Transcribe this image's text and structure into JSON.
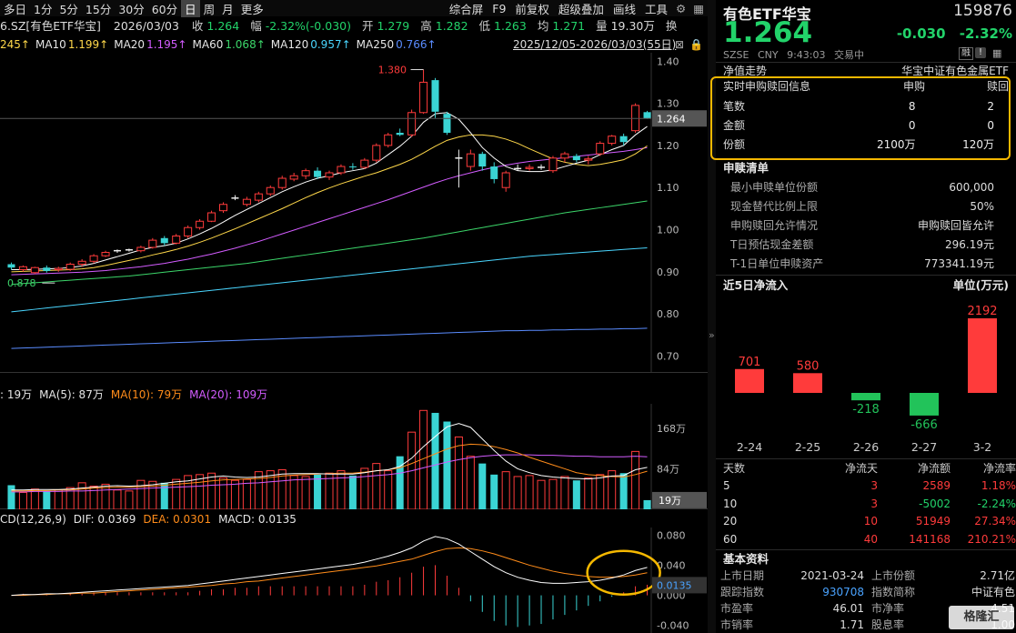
{
  "toolbar": {
    "items": [
      "多日",
      "1分",
      "5分",
      "15分",
      "30分",
      "60分",
      "日",
      "周",
      "月",
      "更多"
    ],
    "active": "日",
    "right_items": [
      "综合屏",
      "F9",
      "前复权",
      "超级叠加",
      "画线",
      "工具"
    ],
    "settings_icon": "gear-icon",
    "menu_icon": "grid-icon"
  },
  "info_row": {
    "code_name": "6.SZ[有色ETF华宝]",
    "date": "2026/03/03",
    "close_label": "收",
    "close_value": "1.264",
    "change_label": "幅",
    "change_value": "-2.32%(-0.030)",
    "open_label": "开",
    "open_value": "1.279",
    "high_label": "高",
    "high_value": "1.282",
    "low_label": "低",
    "low_value": "1.263",
    "avg_label": "均",
    "avg_value": "1.271",
    "volume_label": "量",
    "volume_value": "19.30万",
    "turnover_label": "换"
  },
  "ma_row": {
    "items": [
      {
        "label": "245↑",
        "color": "#ffd84a"
      },
      {
        "label": "MA10",
        "color": "#e6e6e6"
      },
      {
        "label": "1.199↑",
        "color": "#ffd84a"
      },
      {
        "label": "MA20",
        "color": "#e6e6e6"
      },
      {
        "label": "1.195↑",
        "color": "#d35cff"
      },
      {
        "label": "MA60",
        "color": "#e6e6e6"
      },
      {
        "label": "1.068↑",
        "color": "#3cd66a"
      },
      {
        "label": "MA120",
        "color": "#e6e6e6"
      },
      {
        "label": "0.957↑",
        "color": "#4ad6ff"
      },
      {
        "label": "MA250",
        "color": "#e6e6e6"
      },
      {
        "label": "0.766↑",
        "color": "#5a8cff"
      }
    ],
    "range": "2025/12/05-2026/03/03(55日)"
  },
  "price_axis": [
    "1.40",
    "1.30",
    "1.20",
    "1.10",
    "1.00",
    "0.90",
    "0.80",
    "0.70"
  ],
  "price_annotations": {
    "high": "1.380",
    "low": "0.878",
    "current": "1.264"
  },
  "volume_row": {
    "items": [
      {
        "label": ": 19万",
        "color": "#e6e6e6"
      },
      {
        "label": "MA(5): 87万",
        "color": "#e6e6e6"
      },
      {
        "label": "MA(10): 79万",
        "color": "#ff8c1a"
      },
      {
        "label": "MA(20): 109万",
        "color": "#d35cff"
      }
    ],
    "axis": [
      "168万",
      "84万"
    ],
    "current": "19万"
  },
  "macd_row": {
    "items": [
      {
        "label": "CD(12,26,9)",
        "color": "#e6e6e6"
      },
      {
        "label": "DIF: 0.0369",
        "color": "#e6e6e6"
      },
      {
        "label": "DEA: 0.0301",
        "color": "#ff8c1a"
      },
      {
        "label": "MACD: 0.0135",
        "color": "#e6e6e6"
      }
    ],
    "axis": [
      "0.080",
      "0.040",
      "0.000",
      "-0.040"
    ],
    "current": "0.0135"
  },
  "chart_data": {
    "type": "candlestick",
    "candles": [
      {
        "o": 0.918,
        "c": 0.91,
        "h": 0.922,
        "l": 0.905
      },
      {
        "o": 0.905,
        "c": 0.912,
        "h": 0.915,
        "l": 0.9
      },
      {
        "o": 0.898,
        "c": 0.91,
        "h": 0.912,
        "l": 0.895
      },
      {
        "o": 0.91,
        "c": 0.902,
        "h": 0.915,
        "l": 0.898
      },
      {
        "o": 0.905,
        "c": 0.908,
        "h": 0.912,
        "l": 0.9
      },
      {
        "o": 0.906,
        "c": 0.918,
        "h": 0.922,
        "l": 0.902
      },
      {
        "o": 0.918,
        "c": 0.925,
        "h": 0.93,
        "l": 0.912
      },
      {
        "o": 0.925,
        "c": 0.938,
        "h": 0.942,
        "l": 0.92
      },
      {
        "o": 0.938,
        "c": 0.946,
        "h": 0.95,
        "l": 0.935
      },
      {
        "o": 0.95,
        "c": 0.95,
        "h": 0.953,
        "l": 0.945
      },
      {
        "o": 0.952,
        "c": 0.952,
        "h": 0.955,
        "l": 0.948
      },
      {
        "o": 0.95,
        "c": 0.958,
        "h": 0.962,
        "l": 0.946
      },
      {
        "o": 0.958,
        "c": 0.975,
        "h": 0.98,
        "l": 0.955
      },
      {
        "o": 0.98,
        "c": 0.968,
        "h": 0.985,
        "l": 0.962
      },
      {
        "o": 0.968,
        "c": 0.985,
        "h": 0.99,
        "l": 0.965
      },
      {
        "o": 0.985,
        "c": 1.005,
        "h": 1.01,
        "l": 0.98
      },
      {
        "o": 1.005,
        "c": 1.02,
        "h": 1.025,
        "l": 1.0
      },
      {
        "o": 1.02,
        "c": 1.04,
        "h": 1.045,
        "l": 1.018
      },
      {
        "o": 1.045,
        "c": 1.06,
        "h": 1.065,
        "l": 1.04
      },
      {
        "o": 1.075,
        "c": 1.075,
        "h": 1.082,
        "l": 1.07
      },
      {
        "o": 1.06,
        "c": 1.072,
        "h": 1.078,
        "l": 1.055
      },
      {
        "o": 1.07,
        "c": 1.085,
        "h": 1.09,
        "l": 1.065
      },
      {
        "o": 1.085,
        "c": 1.1,
        "h": 1.105,
        "l": 1.08
      },
      {
        "o": 1.1,
        "c": 1.122,
        "h": 1.128,
        "l": 1.095
      },
      {
        "o": 1.12,
        "c": 1.128,
        "h": 1.135,
        "l": 1.115
      },
      {
        "o": 1.128,
        "c": 1.14,
        "h": 1.145,
        "l": 1.12
      },
      {
        "o": 1.14,
        "c": 1.125,
        "h": 1.148,
        "l": 1.12
      },
      {
        "o": 1.125,
        "c": 1.135,
        "h": 1.14,
        "l": 1.118
      },
      {
        "o": 1.135,
        "c": 1.15,
        "h": 1.155,
        "l": 1.13
      },
      {
        "o": 1.15,
        "c": 1.148,
        "h": 1.158,
        "l": 1.142
      },
      {
        "o": 1.148,
        "c": 1.165,
        "h": 1.17,
        "l": 1.144
      },
      {
        "o": 1.165,
        "c": 1.2,
        "h": 1.205,
        "l": 1.16
      },
      {
        "o": 1.2,
        "c": 1.225,
        "h": 1.23,
        "l": 1.195
      },
      {
        "o": 1.23,
        "c": 1.225,
        "h": 1.24,
        "l": 1.222
      },
      {
        "o": 1.225,
        "c": 1.278,
        "h": 1.285,
        "l": 1.22
      },
      {
        "o": 1.278,
        "c": 1.35,
        "h": 1.38,
        "l": 1.275
      },
      {
        "o": 1.355,
        "c": 1.28,
        "h": 1.36,
        "l": 1.265
      },
      {
        "o": 1.275,
        "c": 1.23,
        "h": 1.28,
        "l": 1.225
      },
      {
        "o": 1.17,
        "c": 1.17,
        "h": 1.19,
        "l": 1.1
      },
      {
        "o": 1.15,
        "c": 1.18,
        "h": 1.19,
        "l": 1.14
      },
      {
        "o": 1.18,
        "c": 1.15,
        "h": 1.185,
        "l": 1.14
      },
      {
        "o": 1.15,
        "c": 1.12,
        "h": 1.16,
        "l": 1.11
      },
      {
        "o": 1.1,
        "c": 1.135,
        "h": 1.14,
        "l": 1.09
      },
      {
        "o": 1.145,
        "c": 1.145,
        "h": 1.155,
        "l": 1.14
      },
      {
        "o": 1.145,
        "c": 1.148,
        "h": 1.155,
        "l": 1.14
      },
      {
        "o": 1.148,
        "c": 1.148,
        "h": 1.155,
        "l": 1.142
      },
      {
        "o": 1.14,
        "c": 1.17,
        "h": 1.175,
        "l": 1.135
      },
      {
        "o": 1.17,
        "c": 1.18,
        "h": 1.185,
        "l": 1.16
      },
      {
        "o": 1.175,
        "c": 1.165,
        "h": 1.18,
        "l": 1.16
      },
      {
        "o": 1.165,
        "c": 1.168,
        "h": 1.175,
        "l": 1.155
      },
      {
        "o": 1.18,
        "c": 1.205,
        "h": 1.21,
        "l": 1.175
      },
      {
        "o": 1.205,
        "c": 1.222,
        "h": 1.225,
        "l": 1.2
      },
      {
        "o": 1.222,
        "c": 1.208,
        "h": 1.228,
        "l": 1.2
      },
      {
        "o": 1.235,
        "c": 1.295,
        "h": 1.3,
        "l": 1.23
      },
      {
        "o": 1.279,
        "c": 1.264,
        "h": 1.282,
        "l": 1.263
      }
    ],
    "ma5": [
      0.905,
      0.905,
      0.906,
      0.907,
      0.908,
      0.91,
      0.914,
      0.92,
      0.928,
      0.936,
      0.944,
      0.952,
      0.958,
      0.962,
      0.968,
      0.978,
      0.99,
      1.003,
      1.018,
      1.034,
      1.048,
      1.062,
      1.076,
      1.09,
      1.102,
      1.113,
      1.122,
      1.128,
      1.135,
      1.14,
      1.145,
      1.158,
      1.178,
      1.198,
      1.222,
      1.255,
      1.275,
      1.278,
      1.262,
      1.23,
      1.195,
      1.17,
      1.15,
      1.14,
      1.138,
      1.138,
      1.142,
      1.15,
      1.158,
      1.165,
      1.178,
      1.19,
      1.2,
      1.225,
      1.245
    ],
    "ma10": [
      0.9,
      0.901,
      0.902,
      0.903,
      0.904,
      0.905,
      0.907,
      0.91,
      0.915,
      0.921,
      0.927,
      0.933,
      0.94,
      0.946,
      0.953,
      0.961,
      0.97,
      0.98,
      0.991,
      1.002,
      1.014,
      1.026,
      1.038,
      1.05,
      1.063,
      1.076,
      1.088,
      1.099,
      1.109,
      1.118,
      1.127,
      1.135,
      1.145,
      1.155,
      1.167,
      1.182,
      1.198,
      1.212,
      1.22,
      1.225,
      1.225,
      1.222,
      1.215,
      1.205,
      1.192,
      1.18,
      1.168,
      1.16,
      1.155,
      1.152,
      1.155,
      1.16,
      1.166,
      1.18,
      1.199
    ],
    "ma20": [
      0.893,
      0.894,
      0.895,
      0.896,
      0.897,
      0.898,
      0.899,
      0.901,
      0.903,
      0.906,
      0.909,
      0.912,
      0.916,
      0.92,
      0.925,
      0.93,
      0.936,
      0.942,
      0.949,
      0.956,
      0.964,
      0.972,
      0.981,
      0.99,
      0.999,
      1.008,
      1.017,
      1.026,
      1.035,
      1.044,
      1.053,
      1.062,
      1.071,
      1.081,
      1.091,
      1.101,
      1.111,
      1.12,
      1.128,
      1.135,
      1.142,
      1.148,
      1.153,
      1.158,
      1.162,
      1.165,
      1.168,
      1.171,
      1.174,
      1.177,
      1.18,
      1.183,
      1.186,
      1.19,
      1.195
    ],
    "ma60": [
      0.87,
      0.872,
      0.874,
      0.876,
      0.878,
      0.88,
      0.882,
      0.884,
      0.886,
      0.888,
      0.89,
      0.893,
      0.896,
      0.899,
      0.902,
      0.905,
      0.908,
      0.911,
      0.914,
      0.917,
      0.92,
      0.924,
      0.928,
      0.932,
      0.936,
      0.94,
      0.944,
      0.948,
      0.952,
      0.956,
      0.96,
      0.964,
      0.968,
      0.972,
      0.976,
      0.98,
      0.985,
      0.99,
      0.995,
      1.0,
      1.005,
      1.01,
      1.015,
      1.02,
      1.025,
      1.03,
      1.035,
      1.04,
      1.044,
      1.048,
      1.052,
      1.056,
      1.06,
      1.064,
      1.068
    ],
    "ma120": [
      0.805,
      0.808,
      0.811,
      0.814,
      0.817,
      0.82,
      0.823,
      0.826,
      0.829,
      0.832,
      0.835,
      0.838,
      0.841,
      0.844,
      0.847,
      0.85,
      0.853,
      0.856,
      0.859,
      0.862,
      0.865,
      0.868,
      0.871,
      0.874,
      0.877,
      0.88,
      0.883,
      0.886,
      0.889,
      0.892,
      0.895,
      0.898,
      0.901,
      0.904,
      0.907,
      0.91,
      0.913,
      0.916,
      0.919,
      0.922,
      0.925,
      0.928,
      0.931,
      0.934,
      0.937,
      0.939,
      0.941,
      0.943,
      0.945,
      0.947,
      0.949,
      0.951,
      0.953,
      0.955,
      0.957
    ],
    "ma250": [
      0.718,
      0.719,
      0.72,
      0.721,
      0.722,
      0.723,
      0.724,
      0.725,
      0.726,
      0.727,
      0.728,
      0.729,
      0.73,
      0.731,
      0.732,
      0.733,
      0.734,
      0.735,
      0.736,
      0.737,
      0.738,
      0.739,
      0.74,
      0.741,
      0.742,
      0.743,
      0.744,
      0.745,
      0.746,
      0.747,
      0.748,
      0.749,
      0.75,
      0.751,
      0.752,
      0.753,
      0.754,
      0.755,
      0.756,
      0.757,
      0.758,
      0.759,
      0.76,
      0.76,
      0.761,
      0.761,
      0.762,
      0.762,
      0.763,
      0.763,
      0.764,
      0.764,
      0.765,
      0.765,
      0.766
    ],
    "volume": [
      50,
      35,
      42,
      38,
      40,
      45,
      55,
      48,
      52,
      40,
      38,
      60,
      58,
      55,
      62,
      70,
      72,
      75,
      65,
      60,
      62,
      78,
      80,
      82,
      70,
      68,
      72,
      75,
      80,
      70,
      85,
      95,
      80,
      110,
      160,
      205,
      200,
      182,
      150,
      110,
      95,
      72,
      78,
      68,
      70,
      60,
      62,
      68,
      60,
      65,
      72,
      80,
      75,
      120,
      19
    ],
    "vol_ma5": [
      40,
      40,
      41,
      41,
      41,
      42,
      44,
      46,
      48,
      49,
      48,
      49,
      51,
      54,
      57,
      59,
      63,
      67,
      69,
      67,
      66,
      67,
      70,
      73,
      74,
      74,
      74,
      73,
      73,
      73,
      76,
      80,
      82,
      89,
      106,
      130,
      151,
      171,
      178,
      170,
      146,
      122,
      100,
      84,
      76,
      70,
      67,
      65,
      64,
      63,
      65,
      69,
      70,
      82,
      87
    ],
    "vol_ma10": [
      38,
      38,
      39,
      39,
      40,
      40,
      42,
      44,
      45,
      46,
      46,
      47,
      48,
      50,
      52,
      54,
      56,
      59,
      61,
      62,
      63,
      64,
      66,
      69,
      71,
      72,
      73,
      74,
      75,
      75,
      77,
      80,
      82,
      86,
      95,
      105,
      115,
      125,
      132,
      135,
      134,
      130,
      124,
      117,
      108,
      100,
      92,
      84,
      76,
      72,
      70,
      68,
      67,
      72,
      79
    ],
    "vol_ma20": [
      36,
      36,
      37,
      37,
      37,
      38,
      38,
      39,
      40,
      41,
      42,
      43,
      44,
      45,
      46,
      47,
      48,
      50,
      51,
      52,
      54,
      55,
      57,
      59,
      61,
      62,
      63,
      64,
      65,
      66,
      68,
      70,
      72,
      75,
      80,
      86,
      92,
      98,
      103,
      107,
      110,
      112,
      113,
      113,
      113,
      112,
      112,
      111,
      110,
      110,
      109,
      109,
      109,
      110,
      109
    ],
    "macd_dif": [
      0.0,
      0.001,
      0.001,
      0.002,
      0.002,
      0.003,
      0.004,
      0.005,
      0.006,
      0.007,
      0.008,
      0.009,
      0.01,
      0.011,
      0.012,
      0.013,
      0.015,
      0.017,
      0.019,
      0.021,
      0.023,
      0.025,
      0.027,
      0.029,
      0.031,
      0.033,
      0.035,
      0.037,
      0.039,
      0.041,
      0.044,
      0.048,
      0.052,
      0.057,
      0.063,
      0.072,
      0.078,
      0.075,
      0.068,
      0.058,
      0.048,
      0.038,
      0.03,
      0.024,
      0.02,
      0.017,
      0.016,
      0.016,
      0.017,
      0.018,
      0.02,
      0.023,
      0.027,
      0.033,
      0.037
    ],
    "macd_dea": [
      0.0,
      0.0,
      0.001,
      0.001,
      0.002,
      0.002,
      0.003,
      0.003,
      0.004,
      0.005,
      0.006,
      0.007,
      0.008,
      0.009,
      0.01,
      0.011,
      0.012,
      0.013,
      0.015,
      0.016,
      0.018,
      0.019,
      0.021,
      0.023,
      0.025,
      0.027,
      0.029,
      0.031,
      0.033,
      0.035,
      0.037,
      0.039,
      0.042,
      0.045,
      0.048,
      0.053,
      0.058,
      0.062,
      0.063,
      0.062,
      0.059,
      0.055,
      0.05,
      0.045,
      0.04,
      0.036,
      0.032,
      0.029,
      0.027,
      0.025,
      0.024,
      0.024,
      0.025,
      0.027,
      0.03
    ]
  },
  "quote": {
    "name": "有色ETF华宝",
    "code": "159876",
    "price": "1.264",
    "change": "-0.030",
    "change_pct": "-2.32%",
    "exchange": "SZSE",
    "currency": "CNY",
    "time": "9:43:03",
    "status": "交易中",
    "badge1": "融",
    "badge2": "!"
  },
  "nav_row": {
    "left": "净值走势",
    "right": "华宝中证有色金属ETF"
  },
  "realtime": {
    "title": "实时申购赎回信息",
    "col_sub": "申购",
    "col_red": "赎回",
    "rows": [
      {
        "label": "笔数",
        "sub": "8",
        "red": "2"
      },
      {
        "label": "金额",
        "sub": "0",
        "red": "0"
      },
      {
        "label": "份额",
        "sub": "2100万",
        "red": "120万"
      }
    ]
  },
  "sub_list": {
    "title": "申赎清单",
    "rows": [
      {
        "label": "最小申赎单位份额",
        "value": "600,000"
      },
      {
        "label": "现金替代比例上限",
        "value": "50%"
      },
      {
        "label": "申购赎回允许情况",
        "value": "申购赎回皆允许"
      },
      {
        "label": "T日预估现金差额",
        "value": "296.19元"
      },
      {
        "label": "T-1日单位申赎资产",
        "value": "773341.19元"
      }
    ]
  },
  "flow": {
    "title": "近5日净流入",
    "unit": "单位(万元)",
    "bars": [
      {
        "date": "2-24",
        "value": 701,
        "label": "701"
      },
      {
        "date": "2-25",
        "value": 580,
        "label": "580"
      },
      {
        "date": "2-26",
        "value": -218,
        "label": "-218"
      },
      {
        "date": "2-27",
        "value": -666,
        "label": "-666"
      },
      {
        "date": "3-2",
        "value": 2192,
        "label": "2192"
      }
    ]
  },
  "flow_table": {
    "headers": [
      "天数",
      "净流天",
      "净流额",
      "净流率"
    ],
    "rows": [
      {
        "days": "5",
        "flow_days": "3",
        "amount": "2589",
        "rate": "1.18%",
        "amount_color": "red",
        "rate_color": "red"
      },
      {
        "days": "10",
        "flow_days": "3",
        "amount": "-5002",
        "rate": "-2.24%",
        "amount_color": "green",
        "rate_color": "green"
      },
      {
        "days": "20",
        "flow_days": "10",
        "amount": "51949",
        "rate": "27.34%",
        "amount_color": "red",
        "rate_color": "red"
      },
      {
        "days": "60",
        "flow_days": "40",
        "amount": "141168",
        "rate": "210.21%",
        "amount_color": "red",
        "rate_color": "red"
      }
    ]
  },
  "basic": {
    "title": "基本资料",
    "rows": [
      {
        "l1": "上市日期",
        "v1": "2021-03-24",
        "l2": "上市份额",
        "v2": "2.71亿"
      },
      {
        "l1": "跟踪指数",
        "v1": "930708",
        "l2": "指数简称",
        "v2": "中证有色"
      },
      {
        "l1": "市盈率",
        "v1": "46.01",
        "l2": "市净率",
        "v2": "4.51"
      },
      {
        "l1": "市销率",
        "v1": "1.71",
        "l2": "股息率",
        "v2": "1.00"
      }
    ]
  },
  "watermark": "格隆汇",
  "colors": {
    "up": "#ff3b3b",
    "down": "#3ad4d4",
    "highlight": "#f5b800",
    "ma5": "#ffffff",
    "ma10": "#ffd84a",
    "ma20": "#d35cff",
    "ma60": "#3cd66a",
    "ma120": "#4ad6ff",
    "ma250": "#5a8cff"
  }
}
